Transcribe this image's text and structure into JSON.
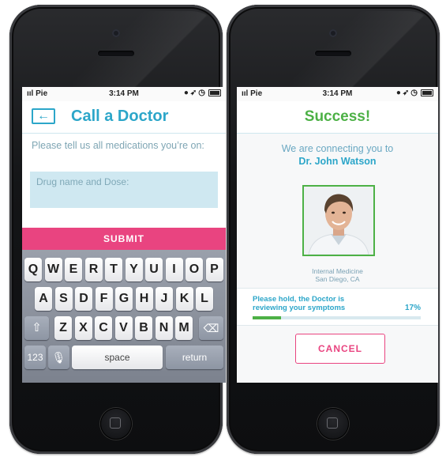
{
  "status_bar": {
    "carrier": "Pie",
    "time": "3:14 PM"
  },
  "call_screen": {
    "title": "Call a Doctor",
    "back_glyph": "←",
    "prompt": "Please tell us all medications you’re on:",
    "drug_placeholder": "Drug name and Dose:",
    "submit_label": "SUBMIT"
  },
  "keyboard": {
    "row1": [
      "Q",
      "W",
      "E",
      "R",
      "T",
      "Y",
      "U",
      "I",
      "O",
      "P"
    ],
    "row2": [
      "A",
      "S",
      "D",
      "F",
      "G",
      "H",
      "J",
      "K",
      "L"
    ],
    "row3": [
      "Z",
      "X",
      "C",
      "V",
      "B",
      "N",
      "M"
    ],
    "numbers_label": "123",
    "space_label": "space",
    "return_label": "return"
  },
  "success_screen": {
    "title": "Success!",
    "connecting_text": "We are connecting you to",
    "doctor_name": "Dr. John Watson",
    "specialty": "Internal Medicine",
    "location": "San Diego, CA",
    "hold_message": "Please hold, the Doctor is reviewing your symptoms",
    "progress_label": "17%",
    "progress_fraction": 0.17,
    "cancel_label": "CANCEL"
  },
  "colors": {
    "accent": "#2ca6c9",
    "success": "#4db146",
    "pink": "#e94480"
  }
}
